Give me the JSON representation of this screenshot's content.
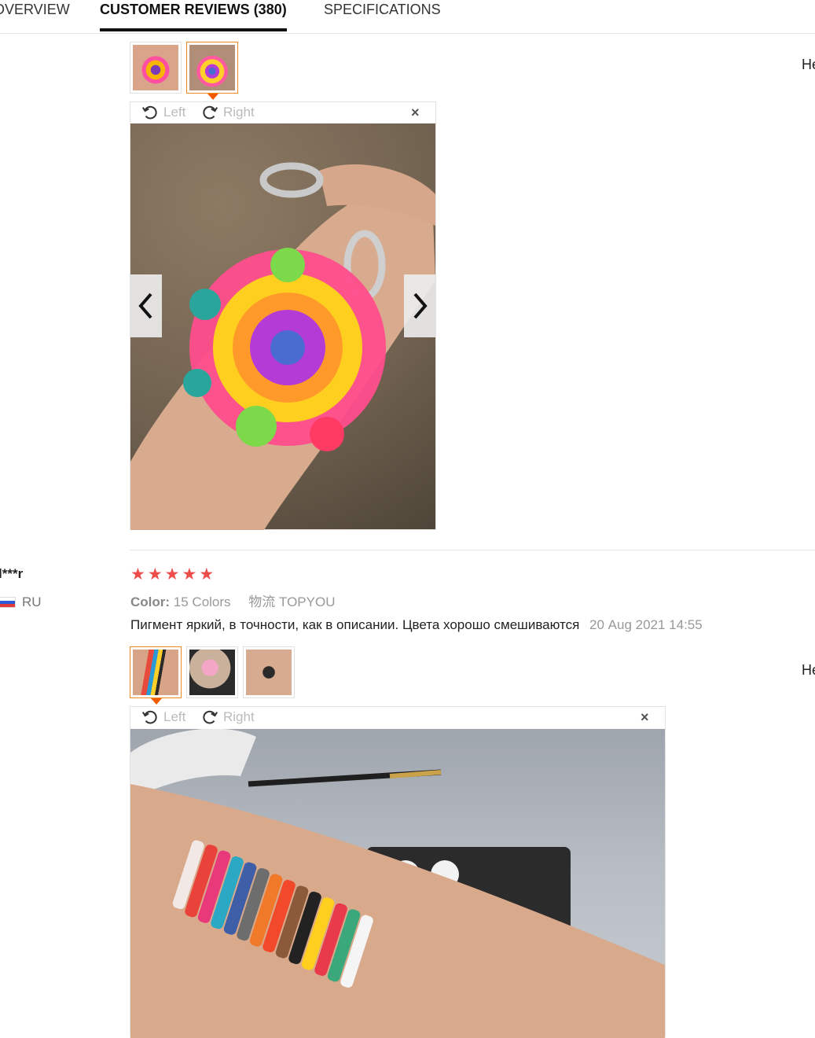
{
  "tabs": {
    "overview": "OVERVIEW",
    "reviews": "CUSTOMER REVIEWS (380)",
    "specifications": "SPECIFICATIONS"
  },
  "viewer": {
    "rotate_left": "Left",
    "rotate_right": "Right",
    "close": "×"
  },
  "side_label": "He",
  "review2": {
    "user": "l***r",
    "country": "RU",
    "rating": 5,
    "color_label": "Color:",
    "color_value": "15 Colors",
    "shipping": "物流 TOPYOU",
    "text": "Пигмент яркий, в точности, как в описании. Цвета хорошо смешиваются",
    "date": "20 Aug 2021 14:55"
  },
  "colors": {
    "accent": "#f08a1c",
    "star": "#ee4b4b"
  }
}
